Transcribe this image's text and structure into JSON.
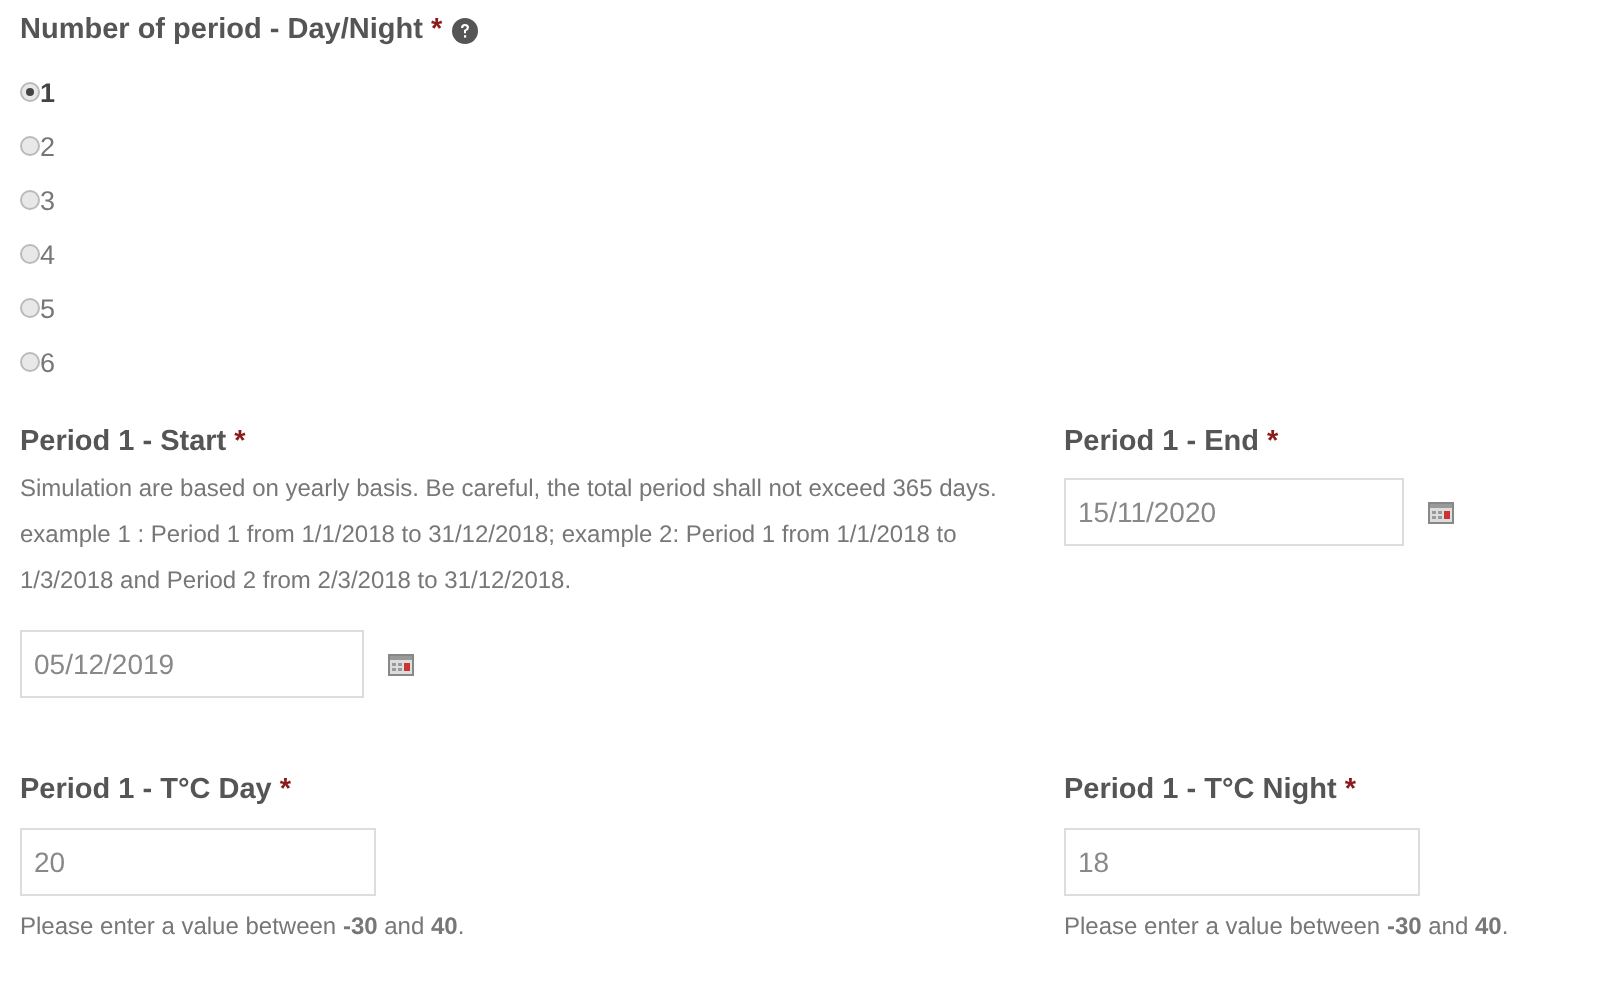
{
  "period_count": {
    "label": "Number of period - Day/Night",
    "required_mark": "*",
    "options": [
      {
        "label": "1",
        "selected": true
      },
      {
        "label": "2",
        "selected": false
      },
      {
        "label": "3",
        "selected": false
      },
      {
        "label": "4",
        "selected": false
      },
      {
        "label": "5",
        "selected": false
      },
      {
        "label": "6",
        "selected": false
      }
    ]
  },
  "start": {
    "label": "Period 1 - Start",
    "required_mark": "*",
    "description": "Simulation are based on yearly basis. Be careful, the total period shall not exceed 365 days. example 1 : Period 1 from 1/1/2018 to 31/12/2018; example 2: Period 1 from 1/1/2018 to 1/3/2018 and Period 2 from 2/3/2018 to 31/12/2018.",
    "value": "05/12/2019"
  },
  "end": {
    "label": "Period 1 - End",
    "required_mark": "*",
    "value": "15/11/2020"
  },
  "temp_day": {
    "label": "Period 1 - T°C Day",
    "required_mark": "*",
    "value": "20",
    "hint": "Please enter a value between **-30** and **40**."
  },
  "temp_night": {
    "label": "Period 1 - T°C Night",
    "required_mark": "*",
    "value": "18",
    "hint": "Please enter a value between **-30** and **40**."
  }
}
